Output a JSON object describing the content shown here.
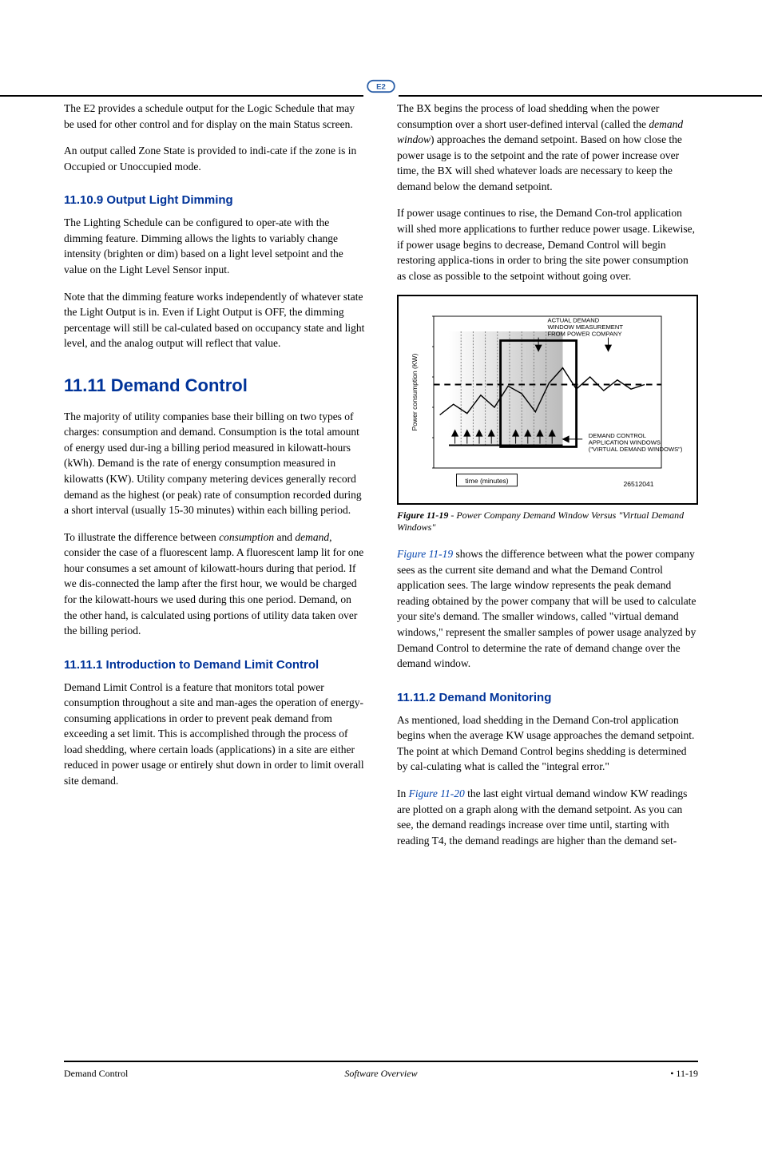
{
  "sections": {
    "pre_9_p1": "The E2 provides a schedule output for the Logic Schedule that may be used for other control and for display on the main Status screen.",
    "pre_9_p2": "An output called Zone State is provided to indi-cate if the zone is in Occupied or Unoccupied mode.",
    "s9_title": "11.10.9  Output Light Dimming",
    "s9_p1": "The Lighting Schedule can be configured to oper-ate with the dimming feature. Dimming allows the lights to variably change intensity (brighten or dim) based on a light level setpoint and the value on the Light Level Sensor input.",
    "s9_p2": "Note that the dimming feature works independently of whatever state the Light Output is in. Even if Light Output is OFF, the dimming percentage will still be cal-culated based on occupancy state and light level, and the analog output will reflect that value.",
    "h11_title": "11.11 Demand Control",
    "h11_p1": "The majority of utility companies base their billing on two types of charges: consumption and demand. Consumption is the total amount of energy used dur-ing a billing period measured in kilowatt-hours (kWh). Demand is the rate of energy consumption measured in kilowatts (KW). Utility company metering devices generally record demand as the highest (or peak) rate of consumption recorded during a short interval (usually 15-30 minutes) within each billing period.",
    "h11_p2_a": "To illustrate the difference between ",
    "h11_p2_b": "consumption",
    "h11_p2_c": " and ",
    "h11_p2_d": "demand",
    "h11_p2_e": ", consider the case of a fluorescent lamp. A fluorescent lamp lit for one hour consumes a set amount of kilowatt-hours during that period. If we dis-connected the lamp after the first hour, we would be charged for the kilowatt-hours we used during this one period. Demand, on the other hand, is calculated using portions of utility data taken over the billing period.",
    "s11_1_title": "11.11.1  Introduction to Demand Limit Control",
    "s11_1_p1": "Demand Limit Control is a feature that monitors total power consumption throughout a site and man-ages the operation of energy-consuming applications in order to prevent peak demand from exceeding a set limit. This is accomplished through the process of load shedding, where certain loads (applications) in a site are either reduced in power usage or entirely shut down in order to limit overall site demand.",
    "col2_p1": "The BX begins the process of load shedding when the power consumption over a short user-defined interval (called the ",
    "col2_p1b": "demand window",
    "col2_p1c": ") approaches the demand setpoint. Based on how close the power usage is to the setpoint and the rate of power increase over time, the BX will shed whatever loads are necessary to keep the demand below the demand setpoint.",
    "col2_p2": "If power usage continues to rise, the Demand Con-trol application will shed more applications to further reduce power usage. Likewise, if power usage begins to decrease, Demand Control will begin restoring applica-tions in order to bring the site power consumption as close as possible to the setpoint without going over.",
    "fig_caption_a": "Figure 11-19",
    "fig_caption_b": " - Power Company Demand Window Versus \"Virtual Demand Windows\"",
    "fig_p1": "Figure 11-19",
    "fig_p1b": " shows the difference between what the power company sees as the current site demand and what the Demand Control application sees. The large window represents the peak demand reading obtained by the power company that will be used to calculate your site's demand. The smaller windows, called \"virtual demand windows,\" represent the smaller samples of power usage analyzed by Demand Control to determine the rate of demand change over the demand window.",
    "s11_2_title": "11.11.2  Demand Monitoring",
    "s11_2_p1": "As mentioned, load shedding in the Demand Con-trol application begins when the average KW usage approaches the demand setpoint. The point at which Demand Control begins shedding is determined by cal-culating what is called the \"integral error.\"",
    "s11_2_p2a": "In ",
    "s11_2_p2b": "Figure 11-20",
    "s11_2_p2c": " the last eight virtual demand window KW readings are plotted on a graph along with the demand setpoint. As you can see, the demand readings increase over time until, starting with reading T4, the demand readings are higher than the demand set-"
  },
  "figure": {
    "label1": "ACTUAL DEMAND",
    "label2": "WINDOW MEASUREMENT",
    "label3": "FROM POWER COMPANY",
    "label4": "DEMAND CONTROL",
    "label5": "APPLICATION WINDOWS",
    "label6": "(\"VIRTUAL DEMAND WINDOWS\")",
    "ylabel": "Power consumption (KW)",
    "xlabel": "time (minutes)",
    "code": "26512041"
  },
  "footer": {
    "left": "Demand Control",
    "center": "Software Overview",
    "right": "• 11-19"
  },
  "chart_data": {
    "type": "line",
    "title": "",
    "xlabel": "time (minutes)",
    "ylabel": "Power consumption (KW)",
    "series": [
      {
        "name": "power",
        "x": [
          0,
          1,
          2,
          3,
          4,
          5,
          6,
          7,
          8,
          9,
          10,
          11,
          12,
          13,
          14,
          15
        ],
        "y": [
          3.0,
          3.6,
          3.2,
          4.2,
          3.6,
          4.6,
          4.2,
          3.4,
          4.8,
          5.6,
          4.6,
          5.2,
          4.6,
          5.1,
          4.7,
          4.9
        ]
      }
    ],
    "reference_line": 5.0,
    "annotations": [
      "ACTUAL DEMAND WINDOW MEASUREMENT FROM POWER COMPANY",
      "DEMAND CONTROL APPLICATION WINDOWS (\"VIRTUAL DEMAND WINDOWS\")"
    ],
    "virtual_windows_count": 8
  }
}
